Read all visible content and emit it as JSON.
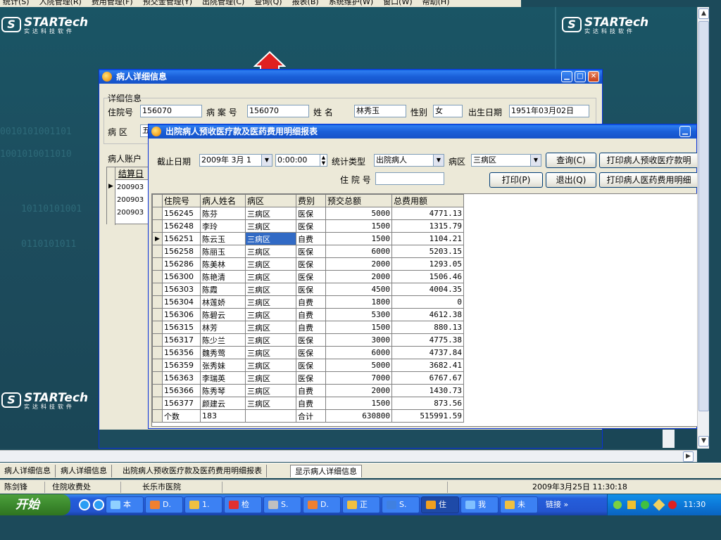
{
  "menubar": [
    "统计(S)",
    "入院管理(R)",
    "费用管理(F)",
    "预交金管理(Y)",
    "出院管理(C)",
    "查询(Q)",
    "报表(B)",
    "系统维护(W)",
    "窗口(W)",
    "帮助(H)"
  ],
  "logo": {
    "name": "STARTech",
    "sub": "实达科技软件"
  },
  "binary_text": [
    "0010101001101",
    "1001010011010",
    "10110101001",
    "0110101011"
  ],
  "detail_window": {
    "title": "病人详细信息",
    "group_label": "详细信息",
    "fields": {
      "admission_no_label": "住院号",
      "admission_no": "156070",
      "record_no_label": "病 案 号",
      "record_no": "156070",
      "name_label": "姓    名",
      "name": "林秀玉",
      "gender_label": "性别",
      "gender": "女",
      "birth_label": "出生日期",
      "birth": "1951年03月02日",
      "ward_label": "病  区",
      "ward": "五"
    },
    "account_label": "病人账户",
    "settle_header": "结算日",
    "settle_rows": [
      "200903",
      "200903",
      "200903"
    ]
  },
  "show_window": {
    "title": "显",
    "query_label": "查询",
    "col": "住"
  },
  "report_window": {
    "title": "出院病人预收医疗款及医药费用明细报表",
    "cutoff_label": "截止日期",
    "cutoff_date": "2009年 3月 1",
    "cutoff_time": "0:00:00",
    "stat_type_label": "统计类型",
    "stat_type": "出院病人",
    "ward_label": "病区",
    "ward": "三病区",
    "admission_label": "住 院 号",
    "admission_value": "",
    "buttons": {
      "query": "查询(C)",
      "print_prepay": "打印病人预收医疗款明",
      "print": "打印(P)",
      "exit": "退出(Q)",
      "print_cost": "打印病人医药费用明细"
    },
    "columns": [
      "住院号",
      "病人姓名",
      "病区",
      "费别",
      "预交总额",
      "总费用额"
    ],
    "rows": [
      [
        "156245",
        "陈芬",
        "三病区",
        "医保",
        "5000",
        "4771.13"
      ],
      [
        "156248",
        "李玲",
        "三病区",
        "医保",
        "1500",
        "1315.79"
      ],
      [
        "156251",
        "陈云玉",
        "三病区",
        "自费",
        "1500",
        "1104.21"
      ],
      [
        "156258",
        "陈丽玉",
        "三病区",
        "医保",
        "6000",
        "5203.15"
      ],
      [
        "156286",
        "陈美林",
        "三病区",
        "医保",
        "2000",
        "1293.05"
      ],
      [
        "156300",
        "陈艳清",
        "三病区",
        "医保",
        "2000",
        "1506.46"
      ],
      [
        "156303",
        "陈霞",
        "三病区",
        "医保",
        "4500",
        "4004.35"
      ],
      [
        "156304",
        "林莲娇",
        "三病区",
        "自费",
        "1800",
        "0"
      ],
      [
        "156306",
        "陈碧云",
        "三病区",
        "自费",
        "5300",
        "4612.38"
      ],
      [
        "156315",
        "林芳",
        "三病区",
        "自费",
        "1500",
        "880.13"
      ],
      [
        "156317",
        "陈少兰",
        "三病区",
        "医保",
        "3000",
        "4775.38"
      ],
      [
        "156356",
        "魏秀莺",
        "三病区",
        "医保",
        "6000",
        "4737.84"
      ],
      [
        "156359",
        "张秀妹",
        "三病区",
        "医保",
        "5000",
        "3682.41"
      ],
      [
        "156363",
        "李瑞英",
        "三病区",
        "医保",
        "7000",
        "6767.67"
      ],
      [
        "156366",
        "陈秀琴",
        "三病区",
        "自费",
        "2000",
        "1430.73"
      ],
      [
        "156377",
        "颜建云",
        "三病区",
        "自费",
        "1500",
        "873.56"
      ]
    ],
    "current_row": 2,
    "footer": {
      "count_label": "个数",
      "count": "183",
      "total_label": "合计",
      "prepay_total": "630800",
      "cost_total": "515991.59"
    }
  },
  "tabs": [
    "病人详细信息",
    "病人详细信息",
    "出院病人预收医疗款及医药费用明细报表",
    "显示病人详细信息"
  ],
  "active_tab": 3,
  "status": {
    "user": "陈剑锋",
    "dept": "住院收费处",
    "hospital": "长乐市医院",
    "datetime": "2009年3月25日 11:30:18"
  },
  "taskbar": {
    "start": "开始",
    "buttons": [
      "本",
      "D.",
      "1.",
      "检",
      "S.",
      "D.",
      "正",
      "S.",
      "住",
      "我",
      "未"
    ],
    "active_button": 8,
    "links": "链接",
    "clock": "11:30"
  }
}
